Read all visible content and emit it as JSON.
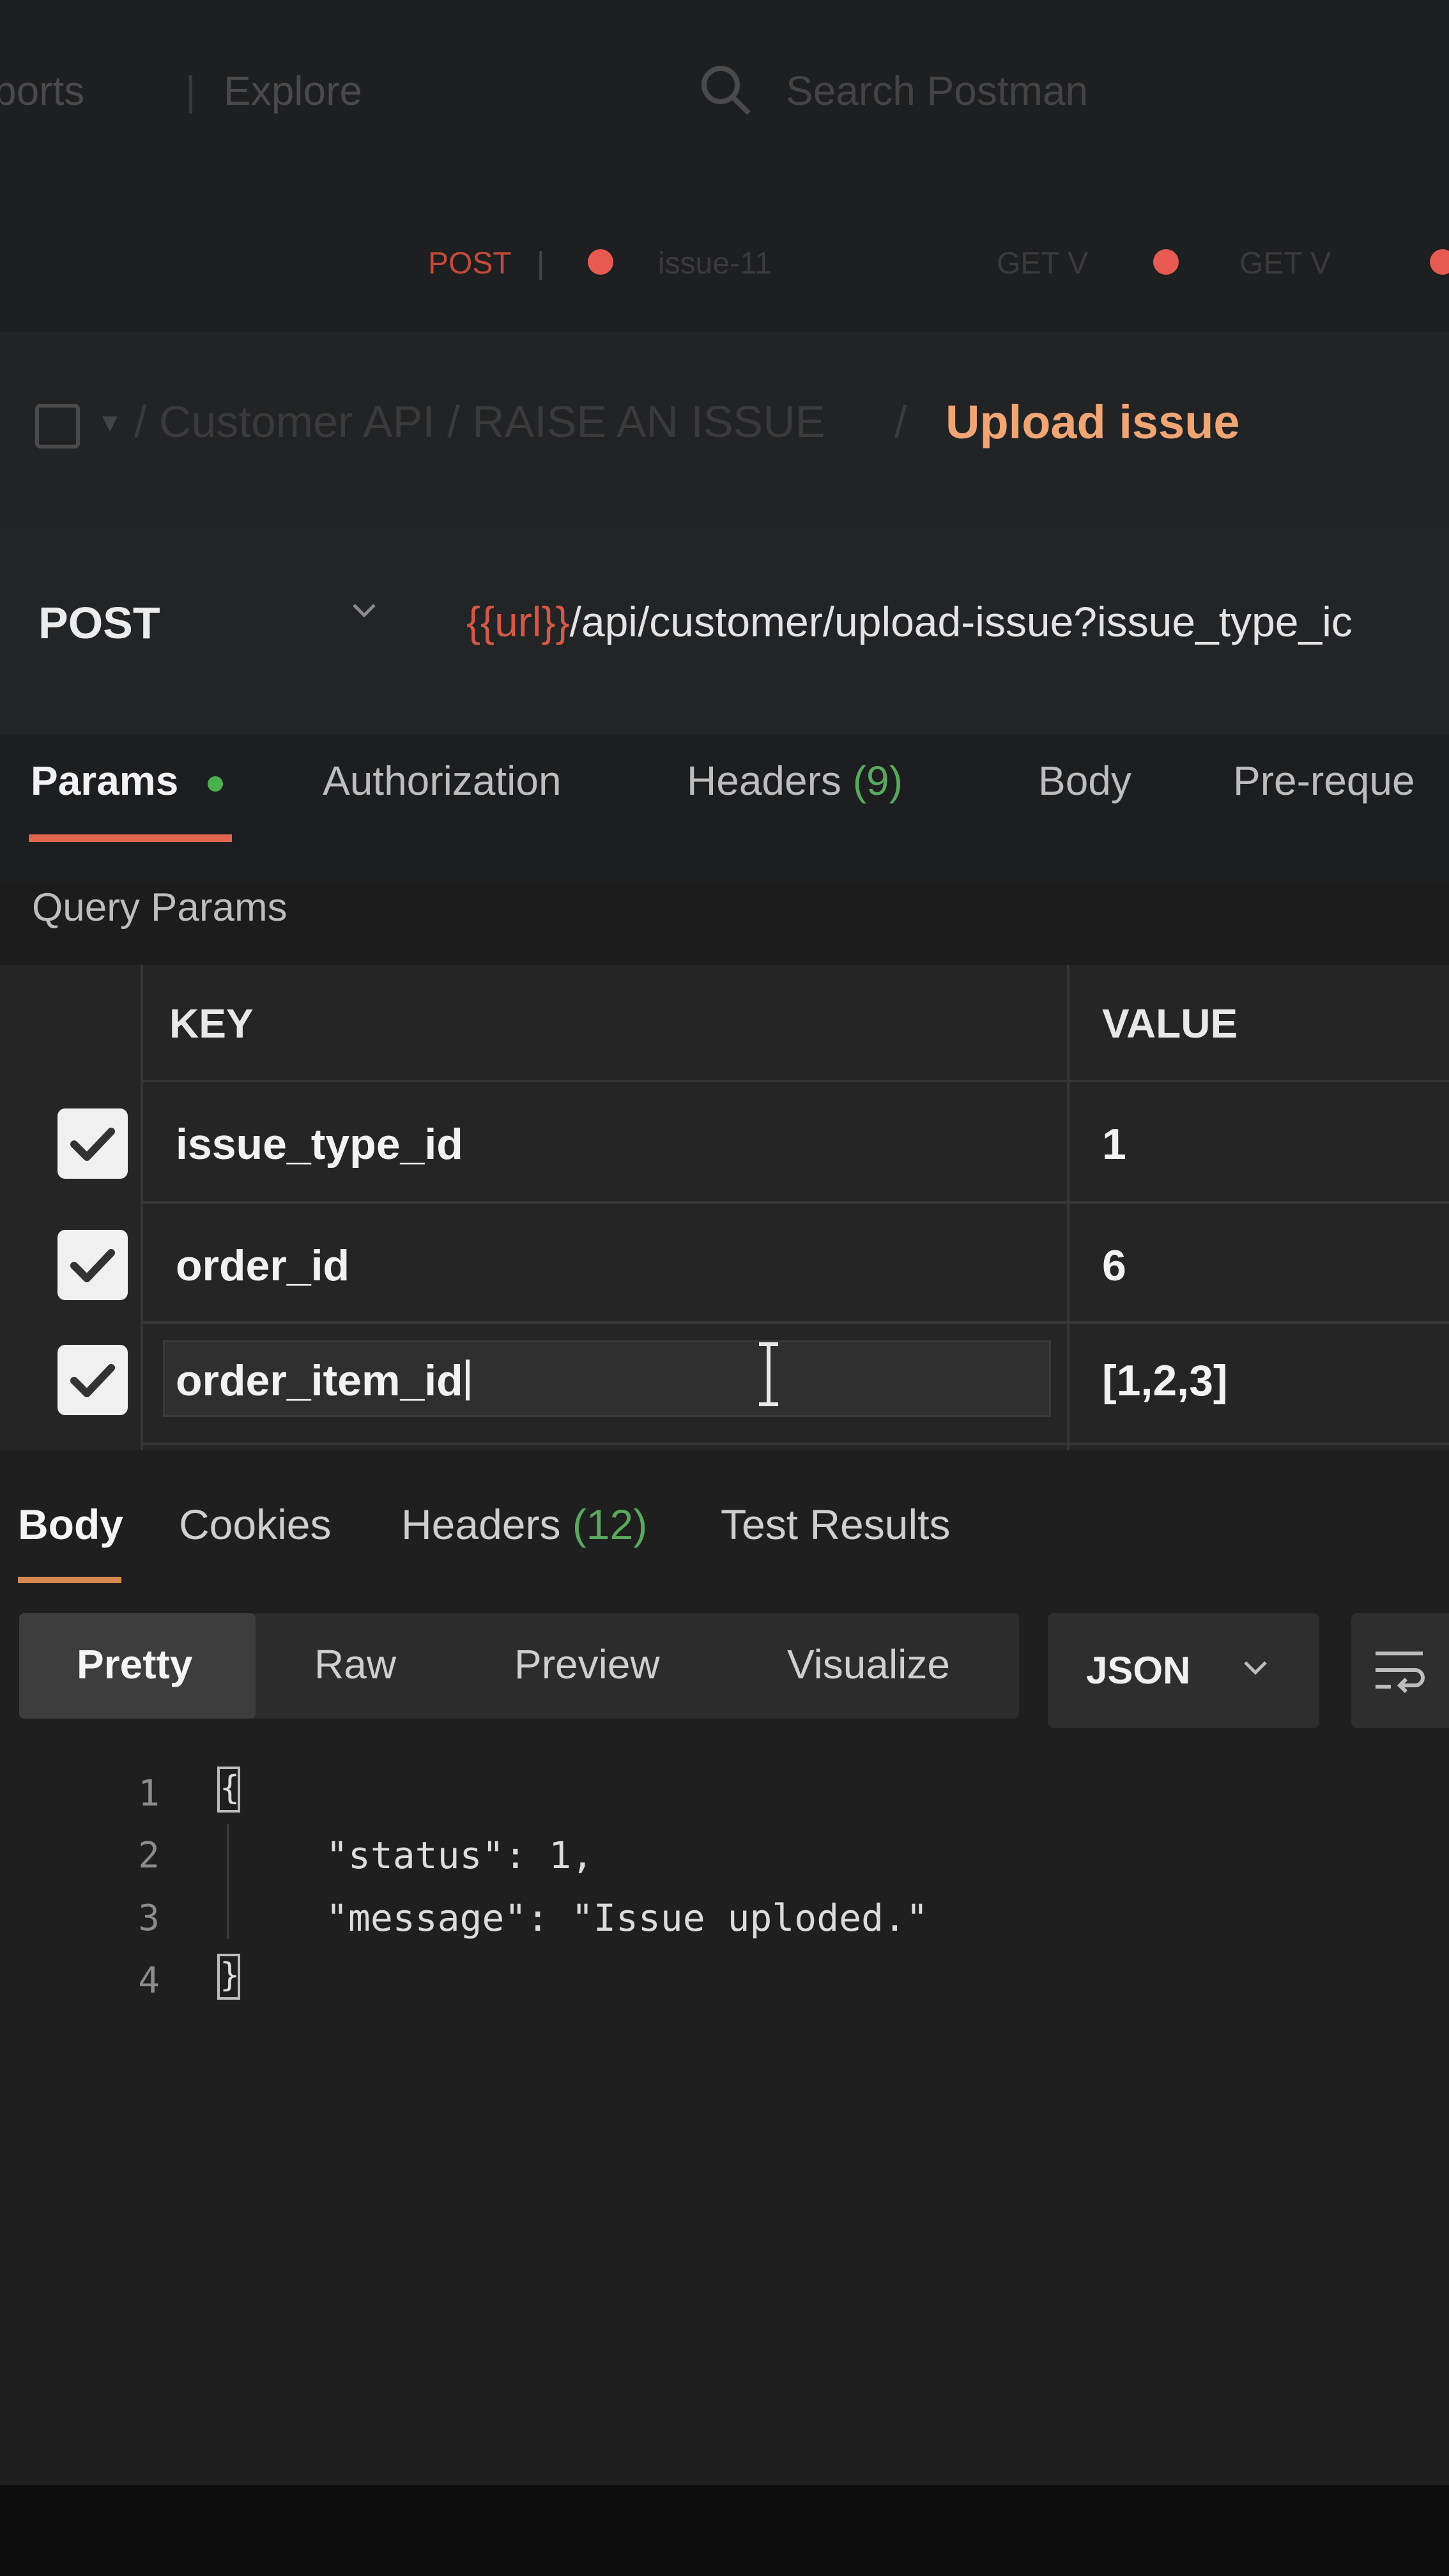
{
  "header": {
    "nav_left": "ports",
    "nav_explore": "Explore",
    "search_placeholder": "Search Postman"
  },
  "open_tabs": [
    {
      "method": "POST",
      "name": ""
    },
    {
      "method": "",
      "name": "issue-11"
    },
    {
      "method": "",
      "name": "GET V"
    },
    {
      "method": "",
      "name": "GET V"
    }
  ],
  "breadcrumb": {
    "path": "/ Customer API / RAISE AN ISSUE",
    "separator": "/",
    "current": "Upload issue"
  },
  "request": {
    "method": "POST",
    "url_variable": "{{url}}",
    "url_path": "/api/customer/upload-issue?issue_type_ic"
  },
  "request_tabs": {
    "params": "Params",
    "authorization": "Authorization",
    "headers_label": "Headers",
    "headers_count": "(9)",
    "body": "Body",
    "prerequest": "Pre-reque"
  },
  "query_params": {
    "title": "Query Params",
    "header_key": "KEY",
    "header_value": "VALUE",
    "rows": [
      {
        "key": "issue_type_id",
        "value": "1",
        "checked": true
      },
      {
        "key": "order_id",
        "value": "6",
        "checked": true
      },
      {
        "key": "order_item_id",
        "value": "[1,2,3]",
        "checked": true
      }
    ]
  },
  "response_tabs": {
    "body": "Body",
    "cookies": "Cookies",
    "headers_label": "Headers",
    "headers_count": "(12)",
    "test_results": "Test Results"
  },
  "format_bar": {
    "pretty": "Pretty",
    "raw": "Raw",
    "preview": "Preview",
    "visualize": "Visualize",
    "language": "JSON"
  },
  "response_body": {
    "line_numbers": [
      "1",
      "2",
      "3",
      "4"
    ],
    "lines": [
      "{",
      "\"status\": 1,",
      "\"message\": \"Issue uploded.\"",
      "}"
    ]
  },
  "colors": {
    "accent": "#e2654f",
    "breadcrumb_current": "#f0a575",
    "url_variable": "#d35848",
    "count_green": "#5aa85e"
  },
  "icons": [
    "search-icon",
    "collection-icon",
    "chevron-down-icon",
    "checkbox-checked-icon",
    "text-cursor-icon",
    "wrap-lines-icon"
  ]
}
